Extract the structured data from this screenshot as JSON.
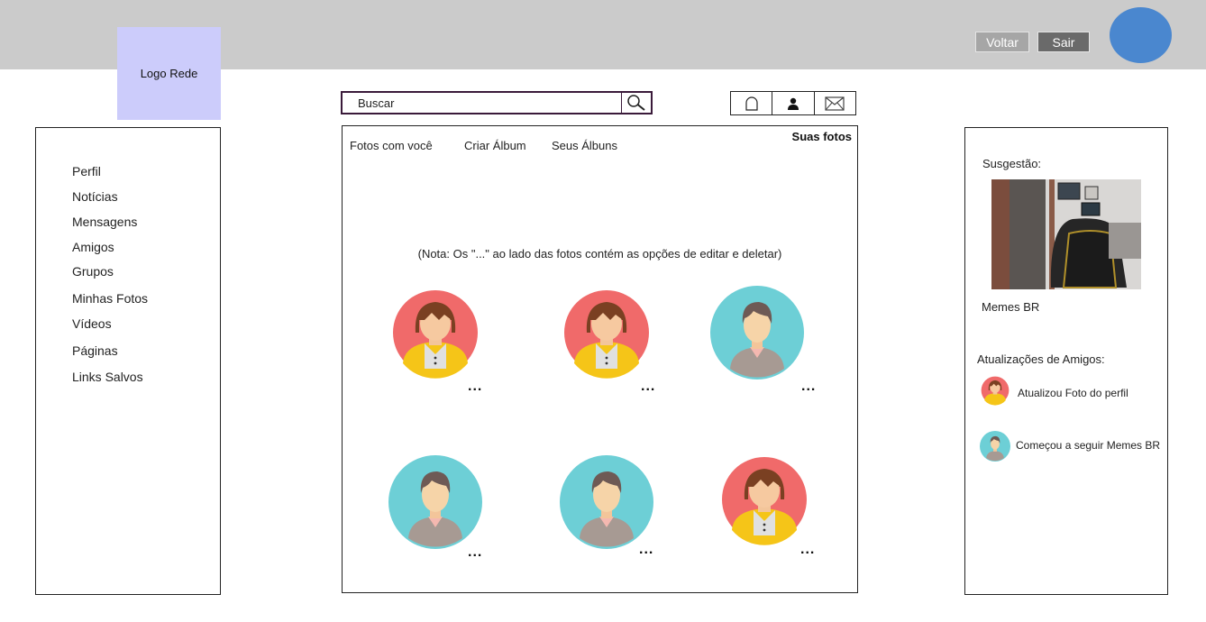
{
  "header": {
    "logo": "Logo Rede",
    "back_label": "Voltar",
    "exit_label": "Sair",
    "avatar_color": "#4a87cf"
  },
  "sidebar": {
    "items": [
      "Perfil",
      "Notícias",
      "Mensagens",
      "Amigos",
      "Grupos",
      "Minhas Fotos",
      "Vídeos",
      "Páginas",
      "Links Salvos"
    ]
  },
  "search": {
    "label": "Buscar",
    "icon": "search-icon"
  },
  "icon_bar": [
    "bell-icon",
    "user-icon",
    "mail-icon"
  ],
  "photos_panel": {
    "tabs": [
      "Fotos com você",
      "Criar Álbum",
      "Seus Álbuns"
    ],
    "heading": "Suas fotos",
    "note": "(Nota: Os \"...\" ao lado das fotos contém as opções de editar e deletar)",
    "options_label": "...",
    "photos": [
      {
        "avatar": "female-avatar",
        "bg": "#f06a6a"
      },
      {
        "avatar": "female-avatar",
        "bg": "#f06a6a"
      },
      {
        "avatar": "male-avatar",
        "bg": "#6dcfd6"
      },
      {
        "avatar": "male-avatar",
        "bg": "#6dcfd6"
      },
      {
        "avatar": "male-avatar",
        "bg": "#6dcfd6"
      },
      {
        "avatar": "female-avatar",
        "bg": "#f06a6a"
      }
    ]
  },
  "right": {
    "suggestion_label": "Susgestão:",
    "suggestion_name": "Memes BR",
    "updates_label": "Atualizações de Amigos:",
    "updates": [
      {
        "avatar": "female-avatar",
        "text": "Atualizou Foto do perfil"
      },
      {
        "avatar": "male-avatar",
        "text": "Começou a seguir Memes BR"
      }
    ]
  }
}
